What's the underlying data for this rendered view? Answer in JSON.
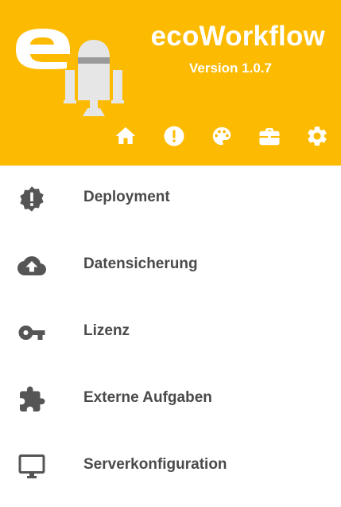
{
  "header": {
    "title": "ecoWorkflow",
    "version": "Version 1.0.7",
    "background": "#FCBA00",
    "logo_text": "e",
    "toolbar": [
      {
        "icon": "home-icon"
      },
      {
        "icon": "alert-icon"
      },
      {
        "icon": "palette-icon"
      },
      {
        "icon": "briefcase-icon"
      },
      {
        "icon": "gear-icon"
      }
    ]
  },
  "menu": {
    "text_color": "#4a4a4a",
    "icon_color": "#555555",
    "items": [
      {
        "label": "Deployment",
        "icon": "alert-badge-icon"
      },
      {
        "label": "Datensicherung",
        "icon": "cloud-upload-icon"
      },
      {
        "label": "Lizenz",
        "icon": "key-icon"
      },
      {
        "label": "Externe Aufgaben",
        "icon": "puzzle-icon"
      },
      {
        "label": "Serverkonfiguration",
        "icon": "monitor-icon"
      }
    ]
  }
}
